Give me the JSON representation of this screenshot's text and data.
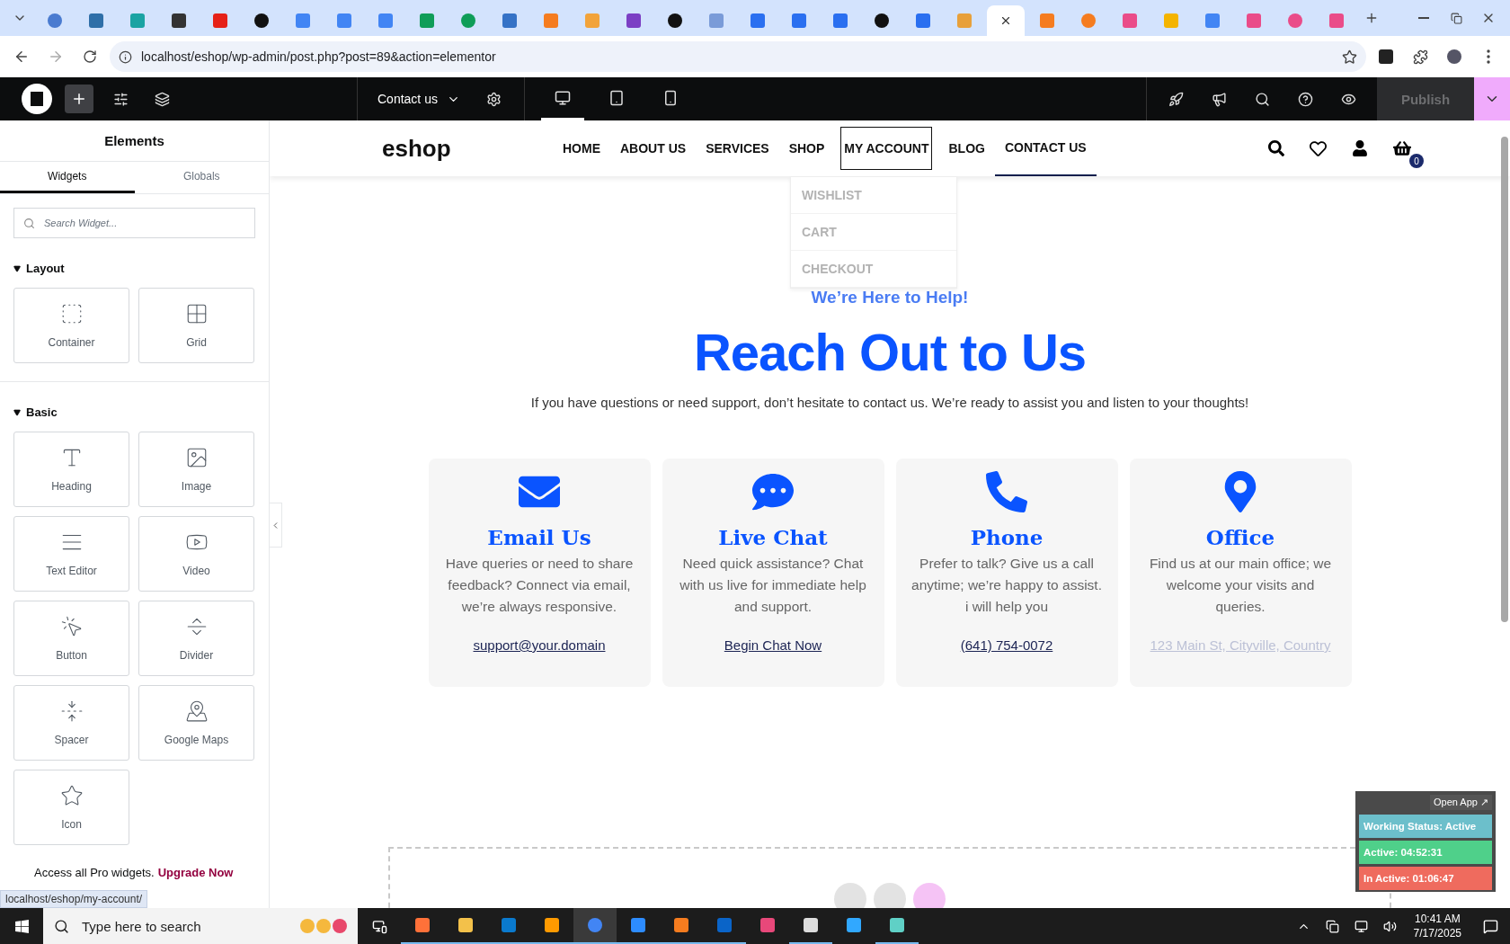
{
  "browser": {
    "tabs": [
      {
        "selected": false
      },
      {
        "selected": false
      },
      {
        "selected": false
      },
      {
        "selected": false
      },
      {
        "selected": false
      },
      {
        "selected": false
      },
      {
        "selected": false
      },
      {
        "selected": false
      },
      {
        "selected": false
      },
      {
        "selected": false
      },
      {
        "selected": false
      },
      {
        "selected": false
      },
      {
        "selected": false
      },
      {
        "selected": false
      },
      {
        "selected": false
      },
      {
        "selected": false
      },
      {
        "selected": false
      },
      {
        "selected": false
      },
      {
        "selected": false
      },
      {
        "selected": false
      },
      {
        "selected": false
      },
      {
        "selected": false
      },
      {
        "selected": false
      },
      {
        "selected": true
      },
      {
        "selected": false
      },
      {
        "selected": false
      },
      {
        "selected": false
      },
      {
        "selected": false
      },
      {
        "selected": false
      },
      {
        "selected": false
      },
      {
        "selected": false
      },
      {
        "selected": false
      }
    ],
    "url": "localhost/eshop/wp-admin/post.php?post=89&action=elementor"
  },
  "editor_bar": {
    "page_title": "Contact us",
    "devices": [
      {
        "selected": true
      },
      {
        "selected": false
      },
      {
        "selected": false
      }
    ],
    "publish": {
      "label": "Publish",
      "disabled": true
    }
  },
  "sidebar": {
    "title": "Elements",
    "tabs": [
      {
        "label": "Widgets",
        "selected": true
      },
      {
        "label": "Globals",
        "selected": false
      }
    ],
    "search": {
      "placeholder": "Search Widget..."
    },
    "sections": [
      {
        "title": "Layout",
        "expanded": true,
        "widgets": [
          "Container",
          "Grid"
        ]
      },
      {
        "title": "Basic",
        "expanded": true,
        "widgets": [
          "Heading",
          "Image",
          "Text Editor",
          "Video",
          "Button",
          "Divider",
          "Spacer",
          "Google Maps",
          "Icon"
        ]
      }
    ],
    "promo": {
      "text": "Access all Pro widgets.",
      "link": "Upgrade Now"
    }
  },
  "site": {
    "logo": "eshop",
    "nav": [
      {
        "label": "HOME",
        "selected": false,
        "outlined": false
      },
      {
        "label": "ABOUT US",
        "selected": false,
        "outlined": false
      },
      {
        "label": "SERVICES",
        "selected": false,
        "outlined": false
      },
      {
        "label": "SHOP",
        "selected": false,
        "outlined": false
      },
      {
        "label": "MY ACCOUNT",
        "selected": false,
        "outlined": true
      },
      {
        "label": "BLOG",
        "selected": false,
        "outlined": false
      },
      {
        "label": "CONTACT US",
        "selected": true,
        "outlined": false
      }
    ],
    "dropdown": [
      "WISHLIST",
      "CART",
      "CHECKOUT"
    ],
    "cart_count": "0",
    "eyebrow": "We’re Here to Help!",
    "heading": "Reach Out to Us",
    "intro": "If you have questions or need support, don’t hesitate to contact us. We’re ready to assist you and listen to your thoughts!",
    "cards": [
      {
        "title": "Email Us",
        "text": "Have queries or need to share feedback? Connect via email, we’re always responsive.",
        "link": "support@your.domain",
        "muted": false
      },
      {
        "title": "Live Chat",
        "text": "Need quick assistance? Chat with us live for immediate help and support.",
        "link": "Begin Chat Now",
        "muted": false
      },
      {
        "title": "Phone",
        "text": "Prefer to talk? Give us a call anytime; we’re happy to assist. i will help you",
        "link": "(641) 754-0072",
        "muted": false
      },
      {
        "title": "Office",
        "text": "Find us at our main office; we welcome your visits and queries.",
        "link": "123 Main St, Cityville, Country",
        "muted": true
      }
    ]
  },
  "tracker": {
    "open_label": "Open App ↗",
    "rows": [
      {
        "text": "Working Status: Active",
        "color": "#6cbfcb"
      },
      {
        "text": "Active: 04:52:31",
        "color": "#4fd08a"
      },
      {
        "text": "In Active: 01:06:47",
        "color": "#ef6b5e"
      }
    ]
  },
  "status_url": "localhost/eshop/my-account/",
  "taskbar": {
    "search_placeholder": "Type here to search",
    "apps": [
      {
        "running": true,
        "selected": false
      },
      {
        "running": true,
        "selected": false
      },
      {
        "running": true,
        "selected": false
      },
      {
        "running": true,
        "selected": false
      },
      {
        "running": true,
        "selected": true
      },
      {
        "running": true,
        "selected": false
      },
      {
        "running": true,
        "selected": false
      },
      {
        "running": true,
        "selected": false
      },
      {
        "running": false,
        "selected": false
      },
      {
        "running": true,
        "selected": false
      },
      {
        "running": false,
        "selected": false
      },
      {
        "running": true,
        "selected": false
      }
    ],
    "time": "10:41 AM",
    "date": "7/17/2025"
  }
}
